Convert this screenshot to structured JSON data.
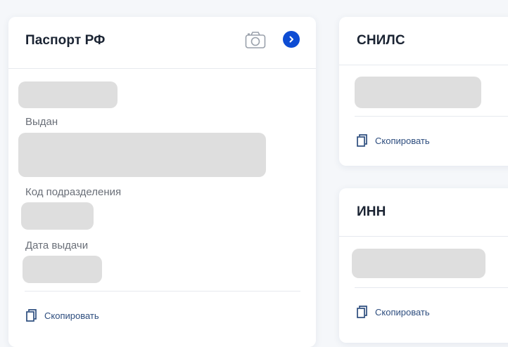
{
  "passport": {
    "title": "Паспорт РФ",
    "issued_label": "Выдан",
    "division_code_label": "Код подразделения",
    "issue_date_label": "Дата выдачи",
    "copy_label": "Скопировать"
  },
  "snils": {
    "title": "СНИЛС",
    "copy_label": "Скопировать"
  },
  "inn": {
    "title": "ИНН",
    "copy_label": "Скопировать"
  },
  "icons": {
    "camera": "camera-icon",
    "chevron": "chevron-right-icon",
    "copy": "copy-icon"
  },
  "colors": {
    "accent": "#0d4cd3",
    "link": "#2d4d7e",
    "placeholder": "#dedede"
  }
}
